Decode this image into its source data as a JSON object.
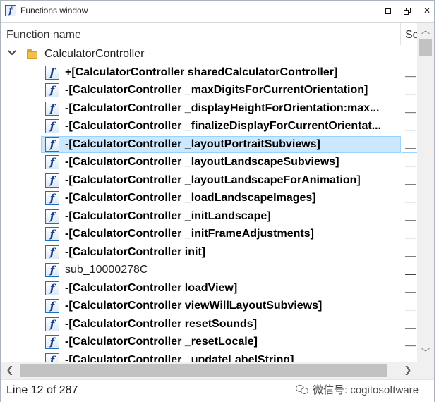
{
  "window": {
    "title": "Functions window",
    "title_icon": "function-f-icon",
    "controls": [
      "maximize-icon",
      "restore-icon",
      "close-icon"
    ]
  },
  "columns": {
    "function_name": "Function name",
    "segment": "Se"
  },
  "tree": {
    "root_label": "CalculatorController",
    "root_expanded": true,
    "rows": [
      {
        "label": "+[CalculatorController sharedCalculatorController]",
        "segment": "__t",
        "bold": true
      },
      {
        "label": "-[CalculatorController _maxDigitsForCurrentOrientation]",
        "segment": "__t",
        "bold": true
      },
      {
        "label": "-[CalculatorController _displayHeightForOrientation:max...",
        "segment": "__t",
        "bold": true
      },
      {
        "label": "-[CalculatorController _finalizeDisplayForCurrentOrientat...",
        "segment": "__t",
        "bold": true
      },
      {
        "label": "-[CalculatorController _layoutPortraitSubviews]",
        "segment": "__t",
        "bold": true,
        "selected": true
      },
      {
        "label": "-[CalculatorController _layoutLandscapeSubviews]",
        "segment": "__t",
        "bold": true
      },
      {
        "label": "-[CalculatorController _layoutLandscapeForAnimation]",
        "segment": "__t",
        "bold": true
      },
      {
        "label": "-[CalculatorController _loadLandscapeImages]",
        "segment": "__t",
        "bold": true
      },
      {
        "label": "-[CalculatorController _initLandscape]",
        "segment": "__t",
        "bold": true
      },
      {
        "label": "-[CalculatorController _initFrameAdjustments]",
        "segment": "__t",
        "bold": true
      },
      {
        "label": "-[CalculatorController init]",
        "segment": "__t",
        "bold": true
      },
      {
        "label": "sub_10000278C",
        "segment": "__t",
        "bold": false
      },
      {
        "label": "-[CalculatorController loadView]",
        "segment": "__t",
        "bold": true
      },
      {
        "label": "-[CalculatorController viewWillLayoutSubviews]",
        "segment": "__t",
        "bold": true
      },
      {
        "label": "-[CalculatorController resetSounds]",
        "segment": "__t",
        "bold": true
      },
      {
        "label": "-[CalculatorController _resetLocale]",
        "segment": "__t",
        "bold": true
      },
      {
        "label": "-[CalculatorController _updateLabelString]",
        "segment": "__t",
        "bold": true
      }
    ]
  },
  "status": {
    "text": "Line 12 of 287"
  },
  "watermark": {
    "text": "微信号: cogitosoftware"
  }
}
